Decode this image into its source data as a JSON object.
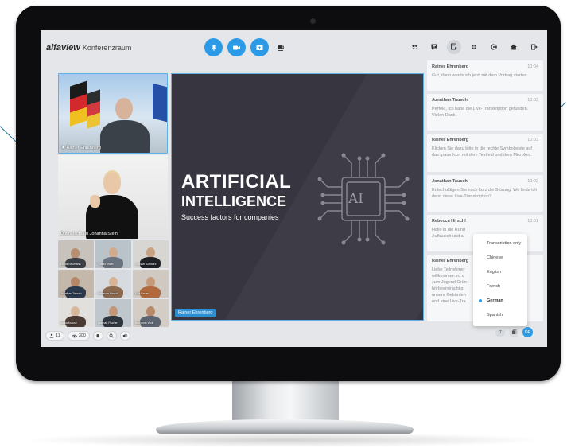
{
  "app": {
    "brand": "alfaview",
    "room": "Konferenzraum"
  },
  "colors": {
    "accent": "#2b9be8",
    "slide_bg": "#363540",
    "chrome": "#e4e6e9"
  },
  "toolbar": {
    "center": [
      "microphone-icon",
      "camera-icon",
      "screenshare-icon",
      "coffee-break-icon"
    ],
    "right": [
      "participants-icon",
      "chat-icon",
      "transcription-icon",
      "grid-layout-icon",
      "settings-icon",
      "home-icon",
      "exit-icon"
    ]
  },
  "videos": {
    "main_speaker": "★ Rainer Ehrenberg",
    "interpreter": "Dolmetscherin Johanna Stein",
    "participants": [
      "Lukas Neumann",
      "Tobias Maier",
      "Michael Schwarz",
      "Jonathan Tausch",
      "Rebecca Hirschl",
      "Lisa Bauer",
      "Maria Krause",
      "Hannah Fischer",
      "Benjamin Wolf"
    ]
  },
  "presentation": {
    "line1": "ARTIFICIAL",
    "line2": "INTELLIGENCE",
    "subtitle": "Success factors for companies",
    "chip": "AI",
    "presenter": "Rainer Ehrenberg"
  },
  "chat": {
    "messages": [
      {
        "name": "Rainer Ehrenberg",
        "time": "10:04",
        "text": "Gut, dann werde ich jetzt mit dem Vortrag starten."
      },
      {
        "name": "Jonathan Tausch",
        "time": "10:03",
        "text": "Perfekt, ich habe die Live-Transkription gefunden. Vielen Dank."
      },
      {
        "name": "Rainer Ehrenberg",
        "time": "10:03",
        "text": "Klicken Sie dazu bitte in die rechte Symbolleiste auf das graue Icon mit dem Textfeld und dem Mikrofon."
      },
      {
        "name": "Jonathan Tausch",
        "time": "10:02",
        "text": "Entschuldigen Sie noch kurz die Störung. Wo finde ich denn diese Live-Transkription?"
      },
      {
        "name": "Rebecca Hirschl",
        "time": "10:01",
        "text": "Hallo in die Rund\nAuftausch und a"
      },
      {
        "name": "Rainer Ehrenberg",
        "time": "",
        "text": "Liebe Teilnehmer\nwillkommen zu u\nzum Jugend Grün\nhörbeeinträchtig\nunsere Gebärden\nund eine Live-Tra"
      }
    ],
    "language_menu": {
      "items": [
        "Transcription only",
        "Chinese",
        "English",
        "French",
        "German",
        "Spanish"
      ],
      "selected": "German"
    },
    "footer": {
      "lang_badge": "DE"
    }
  },
  "stats": {
    "participants": "11",
    "viewers": "300"
  }
}
